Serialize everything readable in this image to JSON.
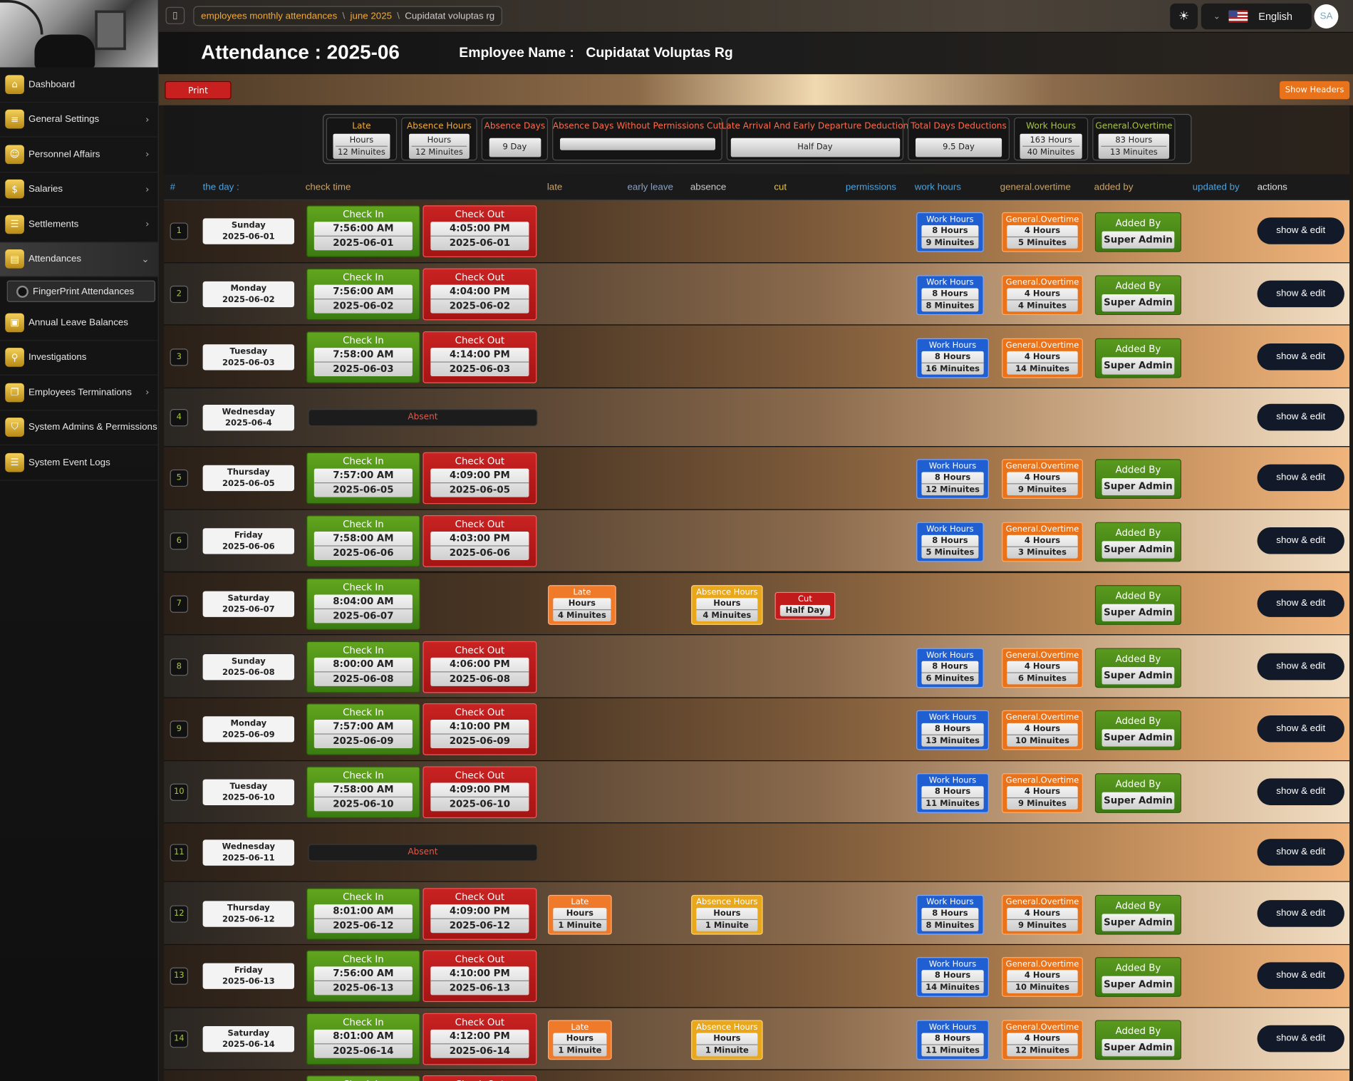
{
  "breadcrumb": [
    "employees monthly attendances",
    "june 2025",
    "Cupidatat voluptas rg"
  ],
  "language": "English",
  "avatar": "SA",
  "title": "Attendance : 2025-06",
  "employee_label": "Employee Name :",
  "employee_name": "Cupidatat Voluptas Rg",
  "print_label": "Print",
  "show_headers_label": "Show Headers",
  "sidebar": [
    {
      "label": "Dashboard",
      "icon": "home-icon",
      "chevron": false
    },
    {
      "label": "General Settings",
      "icon": "sliders-icon",
      "chevron": true
    },
    {
      "label": "Personnel Affairs",
      "icon": "users-icon",
      "chevron": true
    },
    {
      "label": "Salaries",
      "icon": "money-icon",
      "chevron": true
    },
    {
      "label": "Settlements",
      "icon": "list-icon",
      "chevron": true
    },
    {
      "label": "Attendances",
      "icon": "calendar-icon",
      "chevron": true,
      "active": true
    },
    {
      "label": "FingerPrint Attendances",
      "sub": true
    },
    {
      "label": "Annual Leave Balances",
      "icon": "bag-icon",
      "chevron": false
    },
    {
      "label": "Investigations",
      "icon": "search-icon",
      "chevron": false
    },
    {
      "label": "Employees Terminations",
      "icon": "file-icon",
      "chevron": true
    },
    {
      "label": "System Admins & Permissions",
      "icon": "shield-icon",
      "chevron": false
    },
    {
      "label": "System Event Logs",
      "icon": "log-icon",
      "chevron": false
    }
  ],
  "summary": [
    {
      "title": "Late",
      "color": "#f0a93a",
      "lines": [
        "Hours",
        "12 Minuites"
      ]
    },
    {
      "title": "Absence Hours",
      "color": "#f0a93a",
      "lines": [
        "Hours",
        "12 Minuites"
      ]
    },
    {
      "title": "Absence Days",
      "color": "#ff6a4a",
      "lines": [
        "9 Day"
      ]
    },
    {
      "title": "Absence Days Without Permissions Cut",
      "color": "#ff6a4a",
      "lines": [
        ""
      ]
    },
    {
      "title": "Late Arrival And Early Departure Deduction",
      "color": "#ff6a4a",
      "lines": [
        "Half Day"
      ]
    },
    {
      "title": "Total Days Deductions",
      "color": "#ff6a4a",
      "lines": [
        "9.5 Day"
      ]
    },
    {
      "title": "Work Hours",
      "color": "#a7c440",
      "lines": [
        "163 Hours",
        "40 Minuites"
      ]
    },
    {
      "title": "General.Overtime",
      "color": "#a7c440",
      "lines": [
        "83 Hours",
        "13 Minuites"
      ]
    }
  ],
  "columns": [
    {
      "label": "#",
      "color": "#4aa3e0"
    },
    {
      "label": "the day :",
      "color": "#4aa3e0"
    },
    {
      "label": "check time",
      "color": "#c9a36a"
    },
    {
      "label": "late",
      "color": "#c9a36a"
    },
    {
      "label": "early leave",
      "color": "#8aa0c0"
    },
    {
      "label": "absence",
      "color": "#c9c9c9"
    },
    {
      "label": "cut",
      "color": "#e2c24a"
    },
    {
      "label": "permissions",
      "color": "#4aa3e0"
    },
    {
      "label": "work hours",
      "color": "#4aa3e0"
    },
    {
      "label": "general.overtime",
      "color": "#c9a36a"
    },
    {
      "label": "added by",
      "color": "#c9a36a"
    },
    {
      "label": "updated by",
      "color": "#4aa3e0"
    },
    {
      "label": "actions",
      "color": "#e0e0e0"
    }
  ],
  "labels": {
    "check_in": "Check In",
    "check_out": "Check Out",
    "absent": "Absent",
    "late": "Late",
    "absence_hours": "Absence Hours",
    "cut": "Cut",
    "work_hours": "Work Hours",
    "overtime": "General.Overtime",
    "added_by": "Added By",
    "show_edit": "show & edit"
  },
  "rows": [
    {
      "n": "1",
      "day": "Sunday",
      "date": "2025-06-01",
      "in": "7:56:00 AM",
      "out": "4:05:00 PM",
      "work": [
        "8 Hours",
        "9 Minuites"
      ],
      "ot": [
        "4 Hours",
        "5 Minuites"
      ],
      "added": "Super Admin"
    },
    {
      "n": "2",
      "day": "Monday",
      "date": "2025-06-02",
      "in": "7:56:00 AM",
      "out": "4:04:00 PM",
      "work": [
        "8 Hours",
        "8 Minuites"
      ],
      "ot": [
        "4 Hours",
        "4 Minuites"
      ],
      "added": "Super Admin"
    },
    {
      "n": "3",
      "day": "Tuesday",
      "date": "2025-06-03",
      "in": "7:58:00 AM",
      "out": "4:14:00 PM",
      "work": [
        "8 Hours",
        "16 Minuites"
      ],
      "ot": [
        "4 Hours",
        "14 Minuites"
      ],
      "added": "Super Admin"
    },
    {
      "n": "4",
      "day": "Wednesday",
      "date": "2025-06-4",
      "absent": true
    },
    {
      "n": "5",
      "day": "Thursday",
      "date": "2025-06-05",
      "in": "7:57:00 AM",
      "out": "4:09:00 PM",
      "work": [
        "8 Hours",
        "12 Minuites"
      ],
      "ot": [
        "4 Hours",
        "9 Minuites"
      ],
      "added": "Super Admin"
    },
    {
      "n": "6",
      "day": "Friday",
      "date": "2025-06-06",
      "in": "7:58:00 AM",
      "out": "4:03:00 PM",
      "work": [
        "8 Hours",
        "5 Minuites"
      ],
      "ot": [
        "4 Hours",
        "3 Minuites"
      ],
      "added": "Super Admin"
    },
    {
      "n": "7",
      "day": "Saturday",
      "date": "2025-06-07",
      "in": "8:04:00 AM",
      "late": [
        "Hours",
        "4 Minuites"
      ],
      "absence": [
        "Hours",
        "4 Minuites"
      ],
      "cut": "Half Day",
      "added": "Super Admin"
    },
    {
      "n": "8",
      "day": "Sunday",
      "date": "2025-06-08",
      "in": "8:00:00 AM",
      "out": "4:06:00 PM",
      "work": [
        "8 Hours",
        "6 Minuites"
      ],
      "ot": [
        "4 Hours",
        "6 Minuites"
      ],
      "added": "Super Admin"
    },
    {
      "n": "9",
      "day": "Monday",
      "date": "2025-06-09",
      "in": "7:57:00 AM",
      "out": "4:10:00 PM",
      "work": [
        "8 Hours",
        "13 Minuites"
      ],
      "ot": [
        "4 Hours",
        "10 Minuites"
      ],
      "added": "Super Admin"
    },
    {
      "n": "10",
      "day": "Tuesday",
      "date": "2025-06-10",
      "in": "7:58:00 AM",
      "out": "4:09:00 PM",
      "work": [
        "8 Hours",
        "11 Minuites"
      ],
      "ot": [
        "4 Hours",
        "9 Minuites"
      ],
      "added": "Super Admin"
    },
    {
      "n": "11",
      "day": "Wednesday",
      "date": "2025-06-11",
      "absent": true
    },
    {
      "n": "12",
      "day": "Thursday",
      "date": "2025-06-12",
      "in": "8:01:00 AM",
      "out": "4:09:00 PM",
      "late": [
        "Hours",
        "1 Minuite"
      ],
      "absence": [
        "Hours",
        "1 Minuite"
      ],
      "work": [
        "8 Hours",
        "8 Minuites"
      ],
      "ot": [
        "4 Hours",
        "9 Minuites"
      ],
      "added": "Super Admin"
    },
    {
      "n": "13",
      "day": "Friday",
      "date": "2025-06-13",
      "in": "7:56:00 AM",
      "out": "4:10:00 PM",
      "work": [
        "8 Hours",
        "14 Minuites"
      ],
      "ot": [
        "4 Hours",
        "10 Minuites"
      ],
      "added": "Super Admin"
    },
    {
      "n": "14",
      "day": "Saturday",
      "date": "2025-06-14",
      "in": "8:01:00 AM",
      "out": "4:12:00 PM",
      "late": [
        "Hours",
        "1 Minuite"
      ],
      "absence": [
        "Hours",
        "1 Minuite"
      ],
      "work": [
        "8 Hours",
        "11 Minuites"
      ],
      "ot": [
        "4 Hours",
        "12 Minuites"
      ],
      "added": "Super Admin"
    },
    {
      "n": "",
      "day": "",
      "date": "",
      "partial": true
    }
  ]
}
